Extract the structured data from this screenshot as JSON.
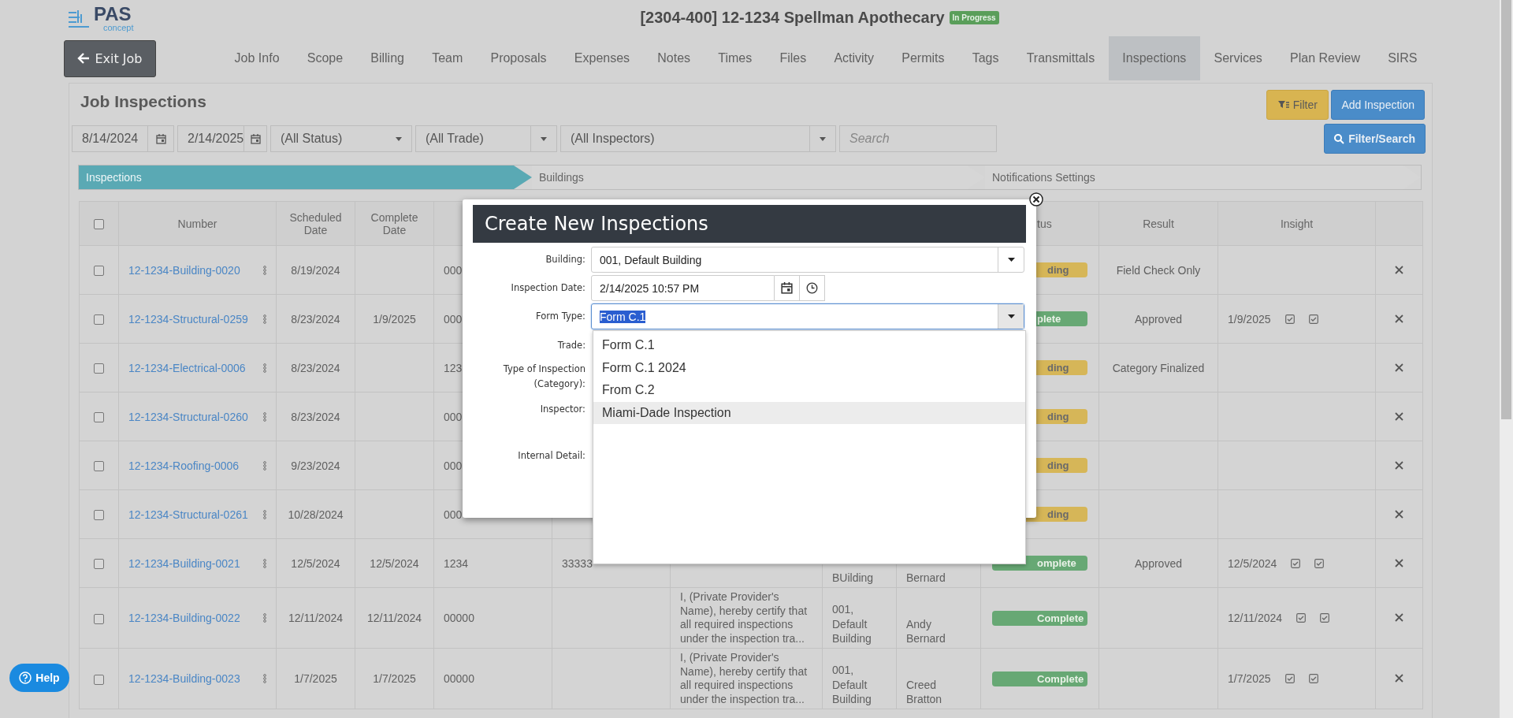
{
  "logo": {
    "name": "PAS",
    "tagline": "concept"
  },
  "job": {
    "title": "[2304-400] 12-1234 Spellman Apothecary",
    "status": "In Progress"
  },
  "exit_button": "Exit Job",
  "tabs": [
    {
      "label": "Job Info",
      "selected": false
    },
    {
      "label": "Scope",
      "selected": false
    },
    {
      "label": "Billing",
      "selected": false
    },
    {
      "label": "Team",
      "selected": false
    },
    {
      "label": "Proposals",
      "selected": false
    },
    {
      "label": "Expenses",
      "selected": false
    },
    {
      "label": "Notes",
      "selected": false
    },
    {
      "label": "Times",
      "selected": false
    },
    {
      "label": "Files",
      "selected": false
    },
    {
      "label": "Activity",
      "selected": false
    },
    {
      "label": "Permits",
      "selected": false
    },
    {
      "label": "Tags",
      "selected": false
    },
    {
      "label": "Transmittals",
      "selected": false
    },
    {
      "label": "Inspections",
      "selected": true
    },
    {
      "label": "Services",
      "selected": false
    },
    {
      "label": "Plan Review",
      "selected": false
    },
    {
      "label": "SIRS",
      "selected": false
    }
  ],
  "panel": {
    "title": "Job Inspections",
    "filter_button": "Filter",
    "add_button": "Add Inspection"
  },
  "filters": {
    "date_from": "8/14/2024",
    "date_to": "2/14/2025",
    "status": "(All Status)",
    "trade": "(All Trade)",
    "inspectors": "(All Inspectors)",
    "search_placeholder": "Search",
    "search_button": "Filter/Search"
  },
  "steps": [
    {
      "label": "Inspections",
      "selected": true
    },
    {
      "label": "Buildings",
      "selected": false
    },
    {
      "label": "Notifications Settings",
      "selected": false
    }
  ],
  "table": {
    "select_all_checked": false,
    "columns": [
      "Number",
      "Scheduled Date",
      "Complete Date",
      "tus",
      "Result",
      "Insight"
    ],
    "rows": [
      {
        "checked": false,
        "number": "12-1234-Building-0020",
        "scheduled": "8/19/2024",
        "complete": "",
        "column_5": "000",
        "column_6": "",
        "column_7": "",
        "column_8": "",
        "column_9": "",
        "status": {
          "text": "ding",
          "kind": "pending"
        },
        "result": "Field Check Only",
        "insight": {}
      },
      {
        "checked": false,
        "number": "12-1234-Structural-0259",
        "scheduled": "8/23/2024",
        "complete": "1/9/2025",
        "column_5": "000",
        "column_6": "",
        "column_7": "",
        "column_8": "",
        "column_9": "",
        "status": {
          "text": "plete",
          "kind": "complete"
        },
        "result": "Approved",
        "insight": {
          "date": "1/9/2025",
          "checks": [
            true,
            true
          ]
        }
      },
      {
        "checked": false,
        "number": "12-1234-Electrical-0006",
        "scheduled": "8/23/2024",
        "complete": "",
        "column_5": "123",
        "column_6": "",
        "column_7": "",
        "column_8": "",
        "column_9": "",
        "status": {
          "text": "ding",
          "kind": "pending"
        },
        "result": "Category Finalized",
        "insight": {}
      },
      {
        "checked": false,
        "number": "12-1234-Structural-0260",
        "scheduled": "8/23/2024",
        "complete": "",
        "column_5": "000",
        "column_6": "",
        "column_7": "",
        "column_8": "",
        "column_9": "",
        "status": {
          "text": "ding",
          "kind": "pending"
        },
        "result": "",
        "insight": {}
      },
      {
        "checked": false,
        "number": "12-1234-Roofing-0006",
        "scheduled": "9/23/2024",
        "complete": "",
        "column_5": "000",
        "column_6": "",
        "column_7": "",
        "column_8": "",
        "column_9": "",
        "status": {
          "text": "ding",
          "kind": "pending"
        },
        "result": "",
        "insight": {}
      },
      {
        "checked": false,
        "number": "12-1234-Structural-0261",
        "scheduled": "10/28/2024",
        "complete": "",
        "column_5": "000",
        "column_6": "",
        "column_7": "",
        "column_8": "",
        "column_9": "",
        "status": {
          "text": "ding",
          "kind": "pending"
        },
        "result": "",
        "insight": {}
      },
      {
        "checked": false,
        "number": "12-1234-Building-0021",
        "scheduled": "12/5/2024",
        "complete": "12/5/2024",
        "column_5": "1234",
        "column_6": "33333",
        "column_7": "",
        "column_8": "BUilding",
        "column_9": "Bernard",
        "status": {
          "text": "omplete",
          "kind": "complete"
        },
        "result": "Approved",
        "insight": {
          "date": "12/5/2024",
          "checks": [
            true,
            true
          ]
        }
      },
      {
        "checked": false,
        "number": "12-1234-Building-0022",
        "scheduled": "12/11/2024",
        "complete": "12/11/2024",
        "column_5": "00000",
        "column_6": "",
        "column_7": "I, (Private Provider's Name), hereby certify that all required inspections under the inspection tra...",
        "column_8": "001, Default Building",
        "column_9": "Andy Bernard",
        "status": {
          "text": "Complete",
          "kind": "complete"
        },
        "result": "",
        "insight": {
          "date": "12/11/2024",
          "checks": [
            true,
            true
          ]
        }
      },
      {
        "checked": false,
        "number": "12-1234-Building-0023",
        "scheduled": "1/7/2025",
        "complete": "1/7/2025",
        "column_5": "00000",
        "column_6": "",
        "column_7": "I, (Private Provider's Name), hereby certify that all required inspections under the inspection tra...",
        "column_8": "001, Default Building",
        "column_9": "Creed Bratton",
        "status": {
          "text": "Complete",
          "kind": "complete"
        },
        "result": "",
        "insight": {
          "date": "1/7/2025",
          "checks": [
            true,
            true
          ]
        }
      }
    ]
  },
  "modal": {
    "title": "Create New Inspections",
    "fields": [
      {
        "label": "Building:",
        "kind": "select",
        "value": "001, Default Building"
      },
      {
        "label": "Inspection Date:",
        "kind": "datetime",
        "value": "2/14/2025 10:57 PM"
      },
      {
        "label": "Form Type:",
        "kind": "combo",
        "value": "Form C.1"
      },
      {
        "label": "Trade:",
        "kind": "label"
      },
      {
        "label": "Type of Inspection (Category):",
        "kind": "label"
      },
      {
        "label": "Inspector:",
        "kind": "label"
      },
      {
        "label": "Internal Detail:",
        "kind": "label"
      }
    ],
    "options": [
      {
        "label": "Form C.1",
        "selected": false
      },
      {
        "label": "Form C.1 2024",
        "selected": false
      },
      {
        "label": "From C.2",
        "selected": false
      },
      {
        "label": "Miami-Dade Inspection",
        "selected": true
      }
    ]
  },
  "help": "Help"
}
